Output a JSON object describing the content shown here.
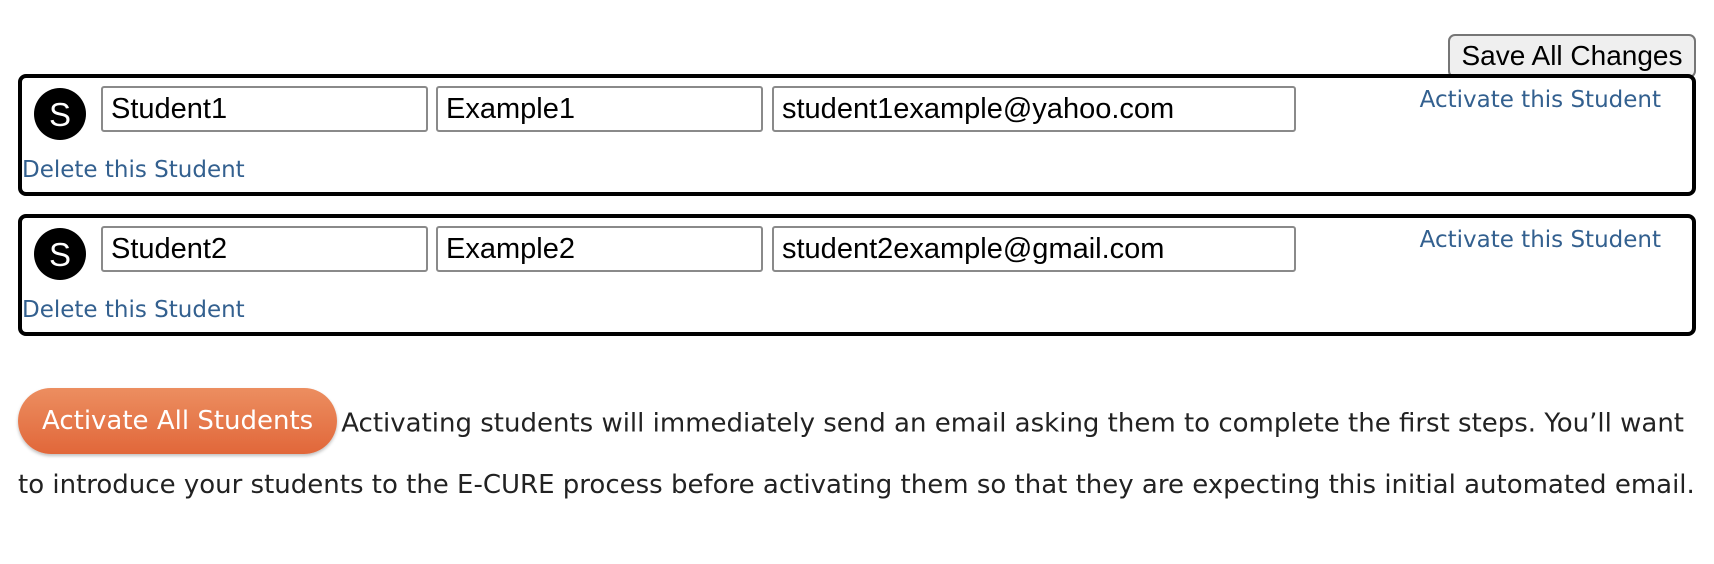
{
  "toolbar": {
    "save_label": "Save All Changes"
  },
  "students": [
    {
      "avatar_letter": "S",
      "first_name": "Student1",
      "last_name": "Example1",
      "email": "student1example@yahoo.com",
      "activate_label": "Activate this Student",
      "delete_label": "Delete this Student"
    },
    {
      "avatar_letter": "S",
      "first_name": "Student2",
      "last_name": "Example2",
      "email": "student2example@gmail.com",
      "activate_label": "Activate this Student",
      "delete_label": "Delete this Student"
    }
  ],
  "footer": {
    "activate_all_label": "Activate All Students",
    "note": "Activating students will immediately send an email asking them to complete the first steps. You’ll want to introduce your students to the E-CURE process before activating them so that they are expecting this initial automated email."
  },
  "colors": {
    "link": "#33608f",
    "accent_button": "#e5733f",
    "card_border": "#000000"
  }
}
